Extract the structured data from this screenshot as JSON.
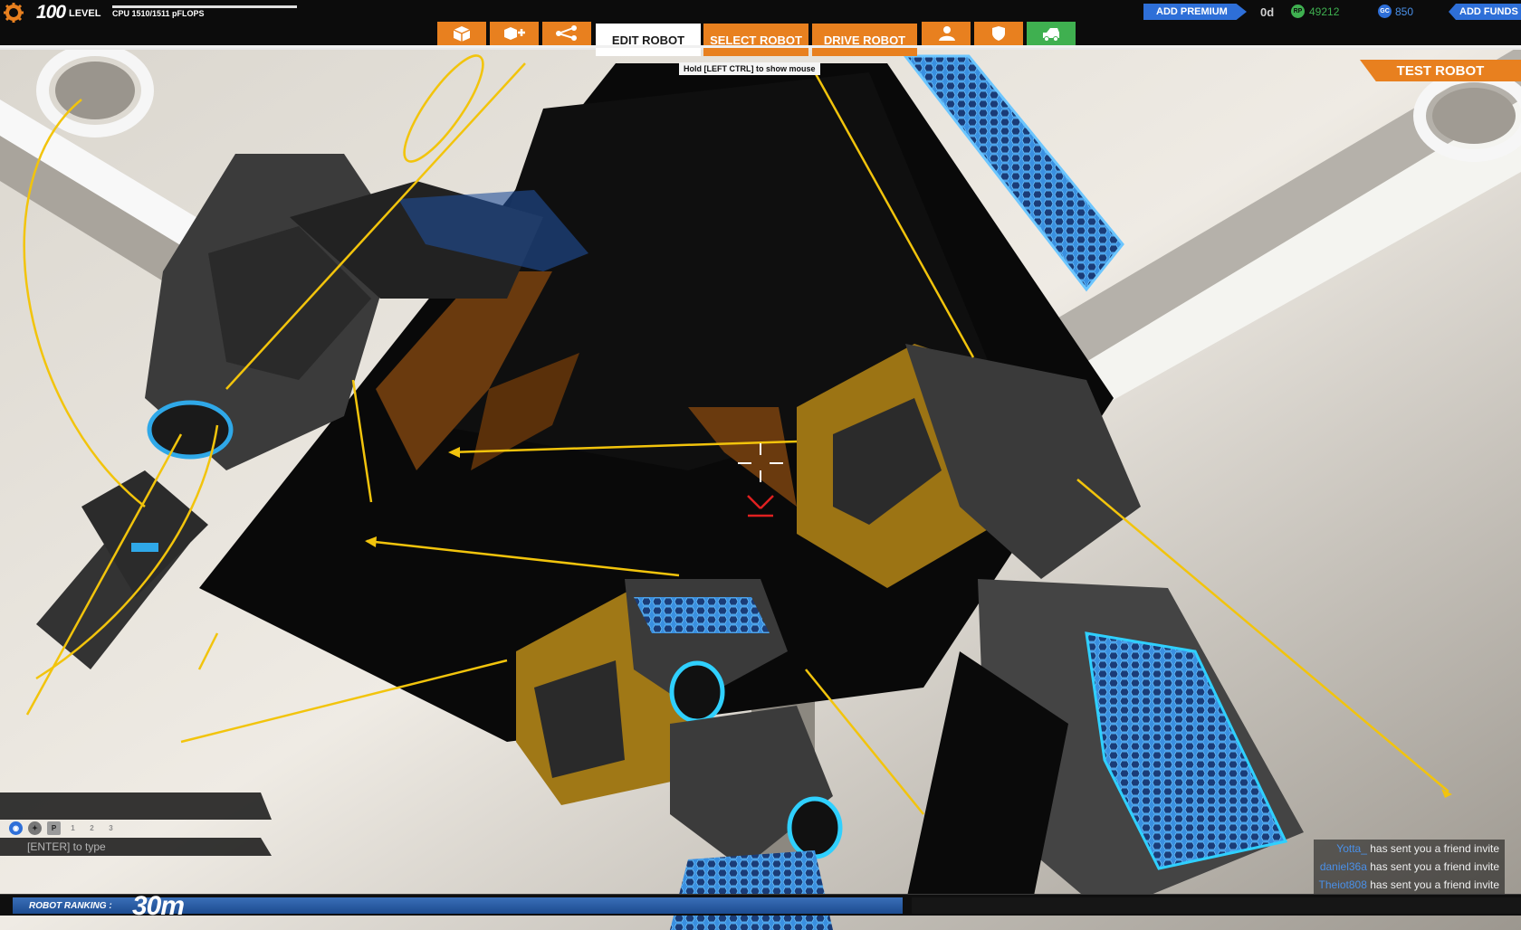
{
  "header": {
    "level_number": "100",
    "level_label": "LEVEL",
    "cpu_text": "CPU 1510/1511 pFLOPS"
  },
  "toolbar": {
    "icons": [
      "cube-icon",
      "cube-plus-icon",
      "share-icon"
    ],
    "modes": {
      "edit": "EDIT ROBOT",
      "select": "SELECT ROBOT",
      "drive": "DRIVE ROBOT"
    },
    "right_icons": [
      "user-icon",
      "shield-icon",
      "garage-icon"
    ]
  },
  "hint": "Hold [LEFT CTRL] to show mouse",
  "economy": {
    "add_premium": "ADD PREMIUM",
    "premium_days": "0d",
    "rp_icon": "RP",
    "rp_value": "49212",
    "gc_icon": "GC",
    "gc_value": "850",
    "add_funds": "ADD FUNDS"
  },
  "test_robot": "TEST ROBOT",
  "chat": {
    "channels": [
      "globe-icon",
      "clan-icon",
      "P",
      "1",
      "2",
      "3"
    ],
    "input_placeholder": "[ENTER] to type"
  },
  "notifications": [
    {
      "who": "Yotta_",
      "msg": "has sent you a friend invite"
    },
    {
      "who": "daniel36a",
      "msg": "has sent you a friend invite"
    },
    {
      "who": "Theiot808",
      "msg": "has sent you a friend invite"
    }
  ],
  "ranking": {
    "label": "ROBOT RANKING :",
    "value": "30m",
    "progress_fraction": 0.59
  },
  "colors": {
    "orange": "#e8801f",
    "blue": "#2e6fd8",
    "green": "#3fb050",
    "yellow_gizmo": "#f2c40c"
  }
}
